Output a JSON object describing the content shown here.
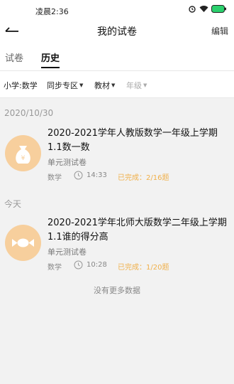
{
  "status": {
    "time": "凌晨2:36"
  },
  "header": {
    "title": "我的试卷",
    "edit_label": "编辑"
  },
  "tabs": [
    {
      "label": "试卷",
      "active": false
    },
    {
      "label": "历史",
      "active": true
    }
  ],
  "filters": [
    {
      "label": "小学:数学",
      "has_caret": false
    },
    {
      "label": "同步专区",
      "has_caret": true
    },
    {
      "label": "教材",
      "has_caret": true
    },
    {
      "label": "年级",
      "has_caret": true,
      "disabled": true
    }
  ],
  "groups": [
    {
      "date": "2020/10/30",
      "items": [
        {
          "title": "2020-2021学年人教版数学一年级上学期1.1数一数",
          "type": "单元测试卷",
          "subject": "数学",
          "time": "14:33",
          "progress": "已完成：2/16题",
          "icon": "money-bag-icon"
        }
      ]
    },
    {
      "date": "今天",
      "items": [
        {
          "title": "2020-2021学年北师大版数学二年级上学期1.1谁的得分高",
          "type": "单元测试卷",
          "subject": "数学",
          "time": "10:28",
          "progress": "已完成：1/20题",
          "icon": "candy-icon"
        }
      ]
    }
  ],
  "footer": {
    "no_more": "没有更多数据"
  },
  "colors": {
    "accent_orange": "#f0b04a",
    "avatar_bg": "#f7cf9d"
  }
}
